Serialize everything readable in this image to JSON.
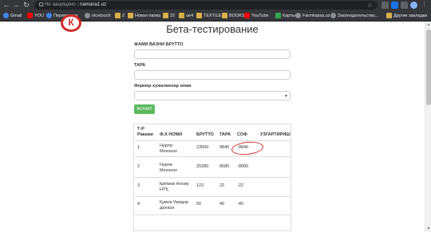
{
  "browser": {
    "url_status": "Не защищено",
    "url": "namuna1.uz",
    "bookmarks": [
      "Gmail",
      "YOU",
      "Переводчик",
      "nicetouch",
      "Z",
      "Новая папка",
      "22",
      "ue4",
      "TEXTILE",
      "BOOKS",
      "YouTube",
      "Карты",
      "Farmkassa.uz",
      "Законодательство...",
      "Другие закладки"
    ]
  },
  "page": {
    "title": "Бета-тестирование",
    "field1_label": "ЖАМИ ВАЗНИ БРУТТО",
    "field2_label": "ТАРА",
    "field3_label": "Фермер хужаликлар номи",
    "submit_label": "ЖОНАТ"
  },
  "table": {
    "headers": {
      "num": [
        "Т-Р",
        "Раками"
      ],
      "name": "Ф.Х НОМИ",
      "brutto": "БРУТТО",
      "tara": "ТАРА",
      "sof": "СОФ",
      "edit": "УЗГАРТИРИШ"
    },
    "rows": [
      {
        "num": "1",
        "name": [
          "Нурли",
          "Мехнкол"
        ],
        "brutto": "23500",
        "tara": "9840",
        "sof": "-9840"
      },
      {
        "num": "2",
        "name": [
          "Нурли",
          "Мехнкол"
        ],
        "brutto": "20280",
        "tara": "8680",
        "sof": "-8680"
      },
      {
        "num": "3",
        "name": [
          "Қиёмов Носир",
          "НТҚ"
        ],
        "brutto": "122",
        "tara": "22",
        "sof": "-22"
      },
      {
        "num": "4",
        "name": [
          "Қумоқ Умидор",
          "даласи"
        ],
        "brutto": "50",
        "tara": "40",
        "sof": "-40"
      }
    ]
  }
}
